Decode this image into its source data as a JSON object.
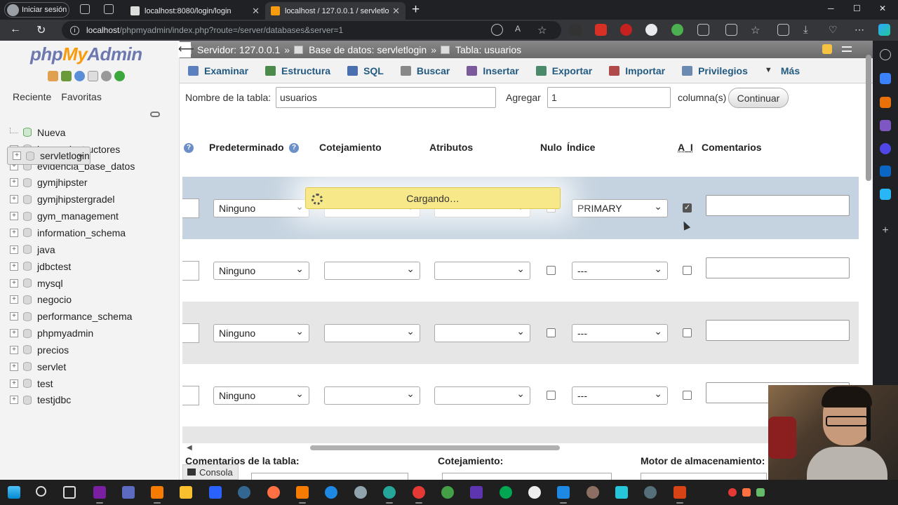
{
  "browser": {
    "profile_label": "Iniciar sesión",
    "tabs": [
      {
        "title": "localhost:8080/login/login",
        "active": false
      },
      {
        "title": "localhost / 127.0.0.1 / servletlogin",
        "active": true
      }
    ],
    "url_host": "localhost",
    "url_path": "/phpmyadmin/index.php?route=/server/databases&server=1"
  },
  "nav": {
    "logo": {
      "php": "php",
      "my": "My",
      "admin": "Admin"
    },
    "tabs": [
      "Reciente",
      "Favoritas"
    ],
    "databases": [
      {
        "name": "Nueva",
        "kind": "new"
      },
      {
        "name": "banco_instructores"
      },
      {
        "name": "evidencia_base_datos"
      },
      {
        "name": "gymjhipster"
      },
      {
        "name": "gymjhipstergradel"
      },
      {
        "name": "gym_management"
      },
      {
        "name": "information_schema"
      },
      {
        "name": "java"
      },
      {
        "name": "jdbctest"
      },
      {
        "name": "mysql"
      },
      {
        "name": "negocio"
      },
      {
        "name": "performance_schema"
      },
      {
        "name": "phpmyadmin"
      },
      {
        "name": "precios"
      },
      {
        "name": "servlet"
      },
      {
        "name": "servletlogin",
        "selected": true
      },
      {
        "name": "test"
      },
      {
        "name": "testjdbc"
      }
    ]
  },
  "breadcrumb": {
    "server": "Servidor: 127.0.0.1",
    "database": "Base de datos: servletlogin",
    "table": "Tabla: usuarios",
    "sep": "»"
  },
  "menu": [
    "Examinar",
    "Estructura",
    "SQL",
    "Buscar",
    "Insertar",
    "Exportar",
    "Importar",
    "Privilegios",
    "Más"
  ],
  "form": {
    "table_name_label": "Nombre de la tabla:",
    "table_name_value": "usuarios",
    "add_label": "Agregar",
    "add_value": "1",
    "columns_label": "columna(s)",
    "continue_label": "Continuar"
  },
  "columns": {
    "default": "Predeterminado",
    "collation": "Cotejamiento",
    "attributes": "Atributos",
    "null": "Nulo",
    "index": "Índice",
    "ai": "A_I",
    "comments": "Comentarios"
  },
  "rows": [
    {
      "default": "Ninguno",
      "index": "PRIMARY",
      "ai_checked": true,
      "null_checked": false
    },
    {
      "default": "Ninguno",
      "index": "---",
      "ai_checked": false,
      "null_checked": false
    },
    {
      "default": "Ninguno",
      "index": "---",
      "ai_checked": false,
      "null_checked": false
    },
    {
      "default": "Ninguno",
      "index": "---",
      "ai_checked": false,
      "null_checked": false
    }
  ],
  "loading_text": "Cargando…",
  "footer": {
    "table_comments": "Comentarios de la tabla:",
    "collation": "Cotejamiento:",
    "engine": "Motor de almacenamiento:",
    "console": "Consola"
  },
  "colors": {
    "link": "#235a81",
    "row_highlight": "#c5d3e0",
    "loading_bg": "#f7e88a"
  }
}
